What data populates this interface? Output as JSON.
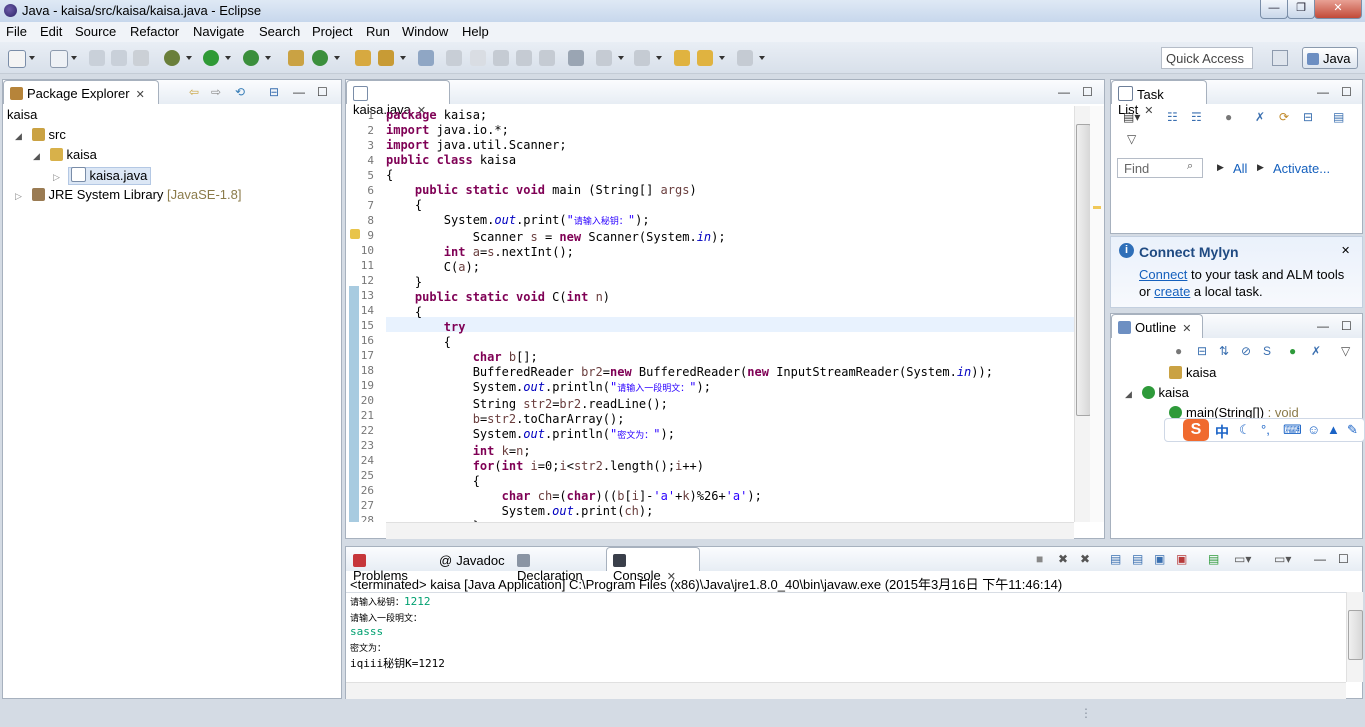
{
  "window": {
    "title": "Java - kaisa/src/kaisa/kaisa.java - Eclipse",
    "min": "—",
    "max": "❐",
    "close": "✕"
  },
  "menu": [
    "File",
    "Edit",
    "Source",
    "Refactor",
    "Navigate",
    "Search",
    "Project",
    "Run",
    "Window",
    "Help"
  ],
  "quick_access": "Quick Access",
  "perspective": "Java",
  "package_explorer": {
    "tab": "Package Explorer",
    "filter": "kaisa",
    "items": [
      {
        "label": "src"
      },
      {
        "label": "kaisa"
      },
      {
        "label": "kaisa.java"
      },
      {
        "label": "JRE System Library",
        "extra": "[JavaSE-1.8]"
      }
    ]
  },
  "editor": {
    "tab": "kaisa.java",
    "line_numbers": [
      "1",
      "2",
      "3",
      "4",
      "5",
      "6",
      "7",
      "8",
      "9",
      "10",
      "11",
      "12",
      "13",
      "14",
      "15",
      "16",
      "17",
      "18",
      "19",
      "20",
      "21",
      "22",
      "23",
      "24",
      "25",
      "26",
      "27",
      "28"
    ]
  },
  "task_list": {
    "tab": "Task List",
    "find_placeholder": "Find",
    "all": "All",
    "activate": "Activate..."
  },
  "mylyn": {
    "title": "Connect Mylyn",
    "connect": "Connect",
    "text1": " to your task and ALM tools",
    "or": "or ",
    "create": "create",
    "text2": " a local task."
  },
  "outline": {
    "tab": "Outline",
    "items": [
      {
        "label": "kaisa"
      },
      {
        "label": "kaisa"
      },
      {
        "label": "main(String[])",
        "type": " : void"
      }
    ]
  },
  "bottom_tabs": [
    "Problems",
    "Javadoc",
    "Declaration",
    "Console"
  ],
  "console": {
    "header": "<terminated> kaisa [Java Application] C:\\Program Files (x86)\\Java\\jre1.8.0_40\\bin\\javaw.exe (2015年3月16日 下午11:46:14)",
    "lines": [
      {
        "prompt": "请输入秘钥：",
        "input": "1212"
      },
      {
        "prompt": "请输入一段明文：",
        "input": ""
      },
      {
        "prompt": "",
        "input": "sasss"
      },
      {
        "prompt": "密文为：",
        "input": ""
      },
      {
        "prompt": "iqiii秘钥K=1212",
        "input": ""
      }
    ]
  },
  "ime": {
    "label": "中"
  }
}
